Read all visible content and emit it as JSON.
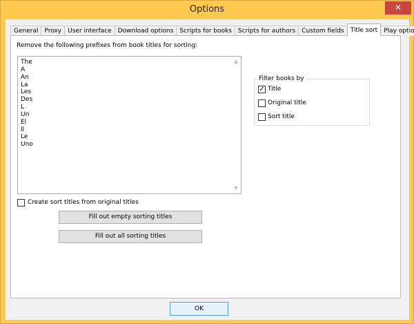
{
  "window": {
    "title": "Options",
    "close_glyph": "✕"
  },
  "tabs": [
    {
      "label": "General"
    },
    {
      "label": "Proxy"
    },
    {
      "label": "User interface"
    },
    {
      "label": "Download options"
    },
    {
      "label": "Scripts for books"
    },
    {
      "label": "Scripts for authors"
    },
    {
      "label": "Custom fields"
    },
    {
      "label": "Title sort",
      "active": true
    },
    {
      "label": "Play options"
    }
  ],
  "title_sort": {
    "prefix_label": "Remove the following prefixes from book titles for sorting:",
    "prefixes": [
      "The",
      "A",
      "An",
      "La",
      "Les",
      "Des",
      "L",
      "Un",
      "El",
      "Il",
      "Le",
      "Uno"
    ],
    "create_sort_label": "Create sort titles from original titles",
    "create_sort_checked": false,
    "fill_empty_label": "Fill out empty sorting titles",
    "fill_all_label": "Fill out all sorting titles",
    "filter": {
      "legend": "Filter books by",
      "options": [
        {
          "label": "Title",
          "checked": true
        },
        {
          "label": "Original title",
          "checked": false
        },
        {
          "label": "Sort title",
          "checked": false
        }
      ]
    }
  },
  "footer": {
    "ok_label": "OK"
  },
  "colors": {
    "title_bar": "#ffc94d",
    "close_button": "#c9463d",
    "ok_border": "#5b9bd5"
  }
}
